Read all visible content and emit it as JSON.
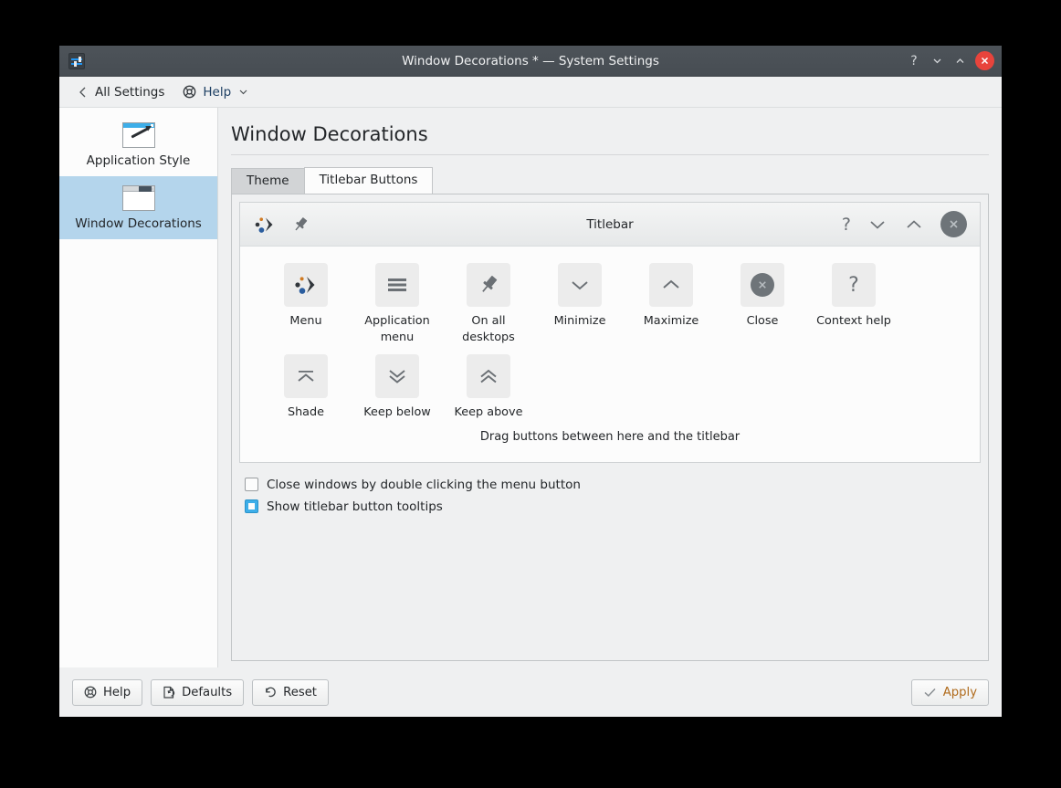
{
  "window": {
    "title": "Window Decorations * — System Settings",
    "icon": "settings-sliders-icon",
    "controls": [
      {
        "name": "context-help-button",
        "glyph": "?"
      },
      {
        "name": "minimize-button",
        "glyph": "chevron-down"
      },
      {
        "name": "maximize-button",
        "glyph": "chevron-up"
      },
      {
        "name": "close-button",
        "glyph": "cross"
      }
    ]
  },
  "toolbar": {
    "back_label": "All Settings",
    "help_label": "Help"
  },
  "sidebar": {
    "items": [
      {
        "label": "Application Style",
        "icon": "application-style-icon",
        "selected": false
      },
      {
        "label": "Window Decorations",
        "icon": "window-decorations-icon",
        "selected": true
      }
    ]
  },
  "main": {
    "page_title": "Window Decorations",
    "tabs": [
      {
        "label": "Theme",
        "active": false
      },
      {
        "label": "Titlebar Buttons",
        "active": true
      }
    ]
  },
  "preview": {
    "titlebar_text": "Titlebar",
    "left_buttons": [
      {
        "name": "menu-button",
        "icon": "kde-menu-icon"
      },
      {
        "name": "on-all-desktops-button",
        "icon": "pin-icon"
      }
    ],
    "right_buttons": [
      {
        "name": "context-help-button",
        "icon": "question-mark-icon"
      },
      {
        "name": "minimize-button",
        "icon": "chevron-down-icon"
      },
      {
        "name": "maximize-button",
        "icon": "chevron-up-icon"
      },
      {
        "name": "close-button",
        "icon": "close-circle-icon"
      }
    ]
  },
  "button_pool": {
    "drag_hint": "Drag buttons between here and the titlebar",
    "rows": [
      [
        {
          "label": "Menu",
          "icon": "kde-menu-icon"
        },
        {
          "label": "Application menu",
          "icon": "hamburger-icon"
        },
        {
          "label": "On all desktops",
          "icon": "pin-icon"
        },
        {
          "label": "Minimize",
          "icon": "chevron-down-icon"
        },
        {
          "label": "Maximize",
          "icon": "chevron-up-icon"
        },
        {
          "label": "Close",
          "icon": "close-circle-icon"
        },
        {
          "label": "Context help",
          "icon": "question-mark-icon"
        }
      ],
      [
        {
          "label": "Shade",
          "icon": "shade-icon"
        },
        {
          "label": "Keep below",
          "icon": "double-chevron-down-icon"
        },
        {
          "label": "Keep above",
          "icon": "double-chevron-up-icon"
        }
      ]
    ]
  },
  "options": [
    {
      "label": "Close windows by double clicking the menu button",
      "checked": false
    },
    {
      "label": "Show titlebar button tooltips",
      "checked": true
    }
  ],
  "footer": {
    "help_label": "Help",
    "defaults_label": "Defaults",
    "reset_label": "Reset",
    "apply_label": "Apply"
  },
  "colors": {
    "accent": "#3daee9",
    "selection": "#b4d5ec",
    "titlebar": "#4d5359",
    "close_red": "#e8443c",
    "apply_text": "#b06b1c"
  }
}
